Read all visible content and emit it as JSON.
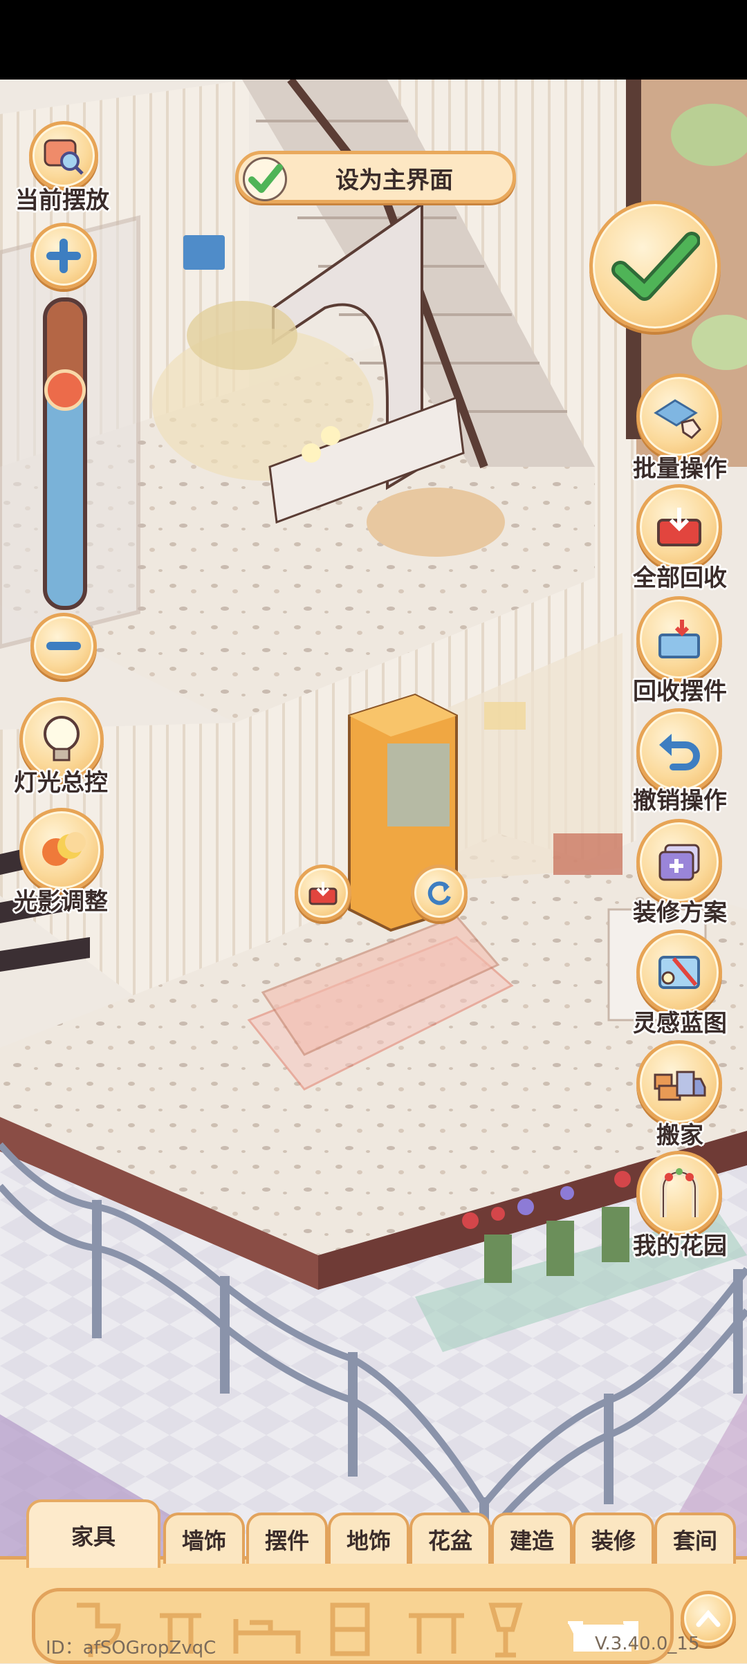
{
  "set_main_screen": {
    "label": "设为主界面",
    "checked": true
  },
  "left_toolbar": {
    "current_placement": "当前摆放",
    "zoom_level": 0.74,
    "lights": "灯光总控",
    "shadow": "光影调整"
  },
  "right_toolbar": [
    {
      "label": "批量操作",
      "icon": "hand-tiles-icon"
    },
    {
      "label": "全部回收",
      "icon": "recycle-tray-icon"
    },
    {
      "label": "回收摆件",
      "icon": "recycle-box-icon"
    },
    {
      "label": "撤销操作",
      "icon": "undo-arrow-icon"
    },
    {
      "label": "装修方案",
      "icon": "plan-cards-icon"
    },
    {
      "label": "灵感蓝图",
      "icon": "blueprint-icon"
    },
    {
      "label": "搬家",
      "icon": "moving-truck-icon"
    },
    {
      "label": "我的花园",
      "icon": "garden-arch-icon"
    }
  ],
  "tabs": [
    "家具",
    "墙饰",
    "摆件",
    "地饰",
    "花盆",
    "建造",
    "装修",
    "套间"
  ],
  "active_tab": "家具",
  "footer": {
    "id": "ID：afSOGropZvqC",
    "version": "V.3.40.0_15"
  },
  "colors": {
    "accent": "#e7a455",
    "confirm_green": "#4fb457",
    "panel": "#fbdca5"
  }
}
